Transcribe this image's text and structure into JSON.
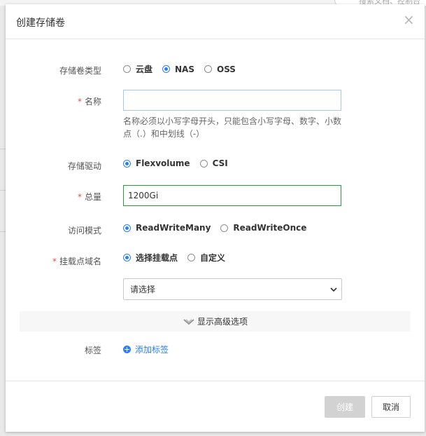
{
  "background": {
    "search_placeholder": "搜索文档、控制台"
  },
  "dialog": {
    "title": "创建存储卷",
    "close_symbol": "×",
    "volume_type": {
      "label": "存储卷类型",
      "options": [
        "云盘",
        "NAS",
        "OSS"
      ],
      "selected": "NAS"
    },
    "name": {
      "label": "名称",
      "required_mark": "*",
      "value": "",
      "help": "名称必须以小写字母开头，只能包含小写字母、数字、小数点（.）和中划线（-）"
    },
    "driver": {
      "label": "存储驱动",
      "options": [
        "Flexvolume",
        "CSI"
      ],
      "selected": "Flexvolume"
    },
    "capacity": {
      "label": "总量",
      "required_mark": "*",
      "value": "1200Gi"
    },
    "access_mode": {
      "label": "访问模式",
      "options": [
        "ReadWriteMany",
        "ReadWriteOnce"
      ],
      "selected": "ReadWriteMany"
    },
    "mount_domain": {
      "label": "挂载点域名",
      "required_mark": "*",
      "options": [
        "选择挂载点",
        "自定义"
      ],
      "selected": "选择挂载点",
      "select_value": "请选择"
    },
    "advanced_label": "显示高级选项",
    "tags": {
      "label": "标签",
      "add_label": "添加标签"
    },
    "footer": {
      "create_label": "创建",
      "cancel_label": "取消"
    }
  },
  "colors": {
    "accent": "#2a7ff5",
    "required": "#e34d43",
    "valid_border": "#2a9a3f",
    "disabled_button": "#d2d2d2"
  }
}
